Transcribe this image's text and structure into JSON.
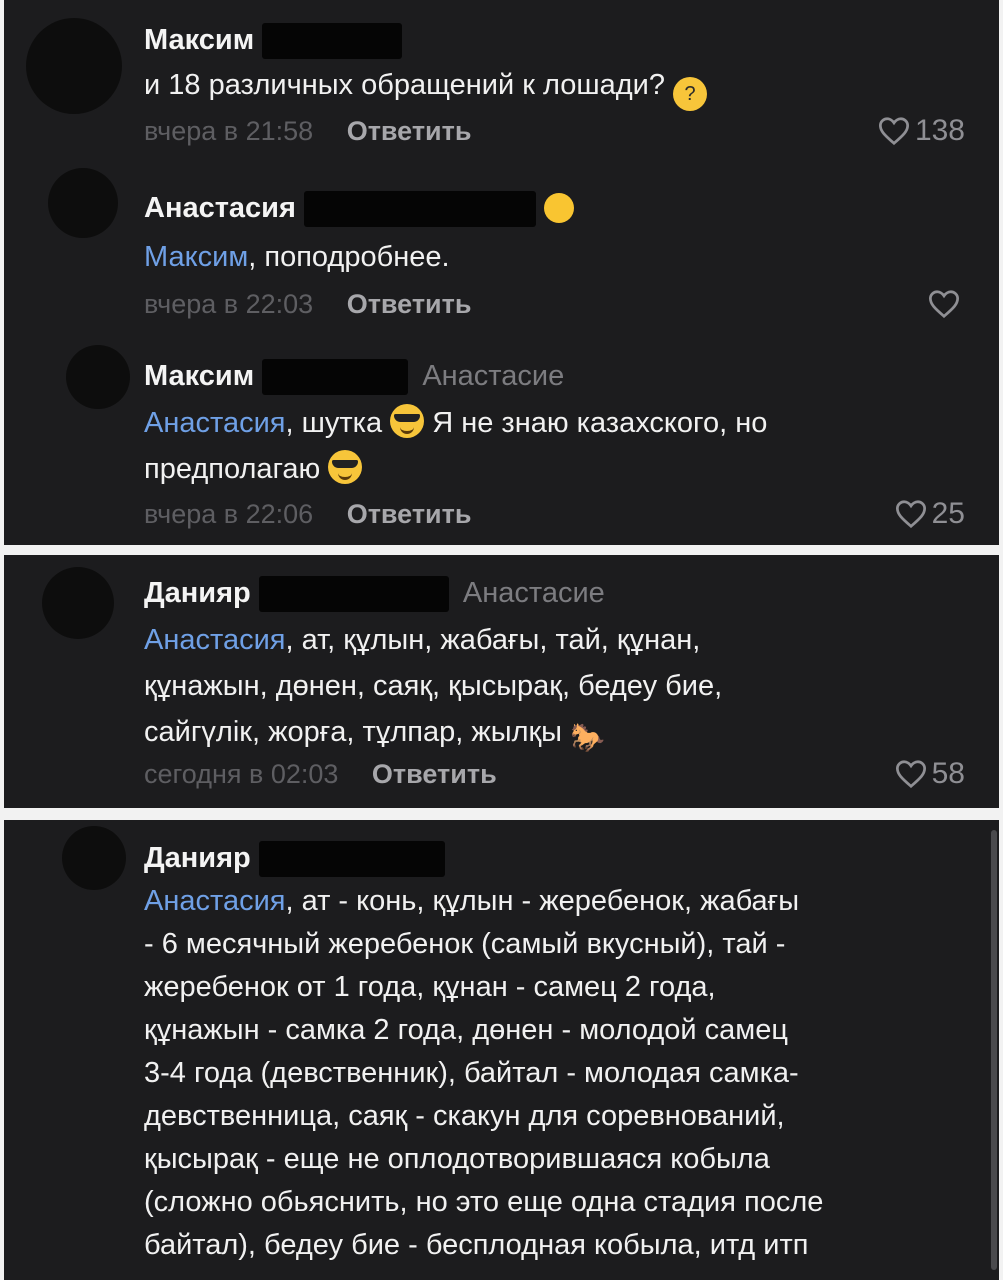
{
  "comments": [
    {
      "author": "Максим",
      "text": "и 18 различных обращений к лошади?",
      "emoji_icon": "thinking-face-icon",
      "time": "вчера в 21:58",
      "reply_label": "Ответить",
      "likes": "138"
    },
    {
      "author": "Анастасия",
      "mention": "Максим",
      "text": ", поподробнее.",
      "time": "вчера в 22:03",
      "reply_label": "Ответить",
      "likes": ""
    },
    {
      "author": "Максим",
      "reply_to": "Анастасие",
      "mention": "Анастасия",
      "text_part1": ", шутка",
      "text_part2": "Я не знаю казахского, но",
      "text_part3": "предполагаю",
      "emoji_icon": "smiling-face-with-sunglasses-icon",
      "time": "вчера в 22:06",
      "reply_label": "Ответить",
      "likes": "25"
    },
    {
      "author": "Данияр",
      "reply_to": "Анастасие",
      "mention": "Анастасия",
      "text_line1": ", ат, құлын, жабағы, тай, құнан,",
      "text_line2": "құнажын, дөнен, саяқ, қысырақ, бедеу бие,",
      "text_line3": "сайгүлік, жорға, тұлпар, жылқы",
      "emoji_icon": "horse-icon",
      "time": "сегодня в 02:03",
      "reply_label": "Ответить",
      "likes": "58"
    },
    {
      "author": "Данияр",
      "mention": "Анастасия",
      "text_line1": ", ат - конь, құлын - жеребенок, жабағы",
      "text_line2": "- 6 месячный жеребенок (самый вкусный), тай -",
      "text_line3": "жеребенок от 1 года, құнан - самец 2 года,",
      "text_line4": "құнажын - самка 2 года, дөнен - молодой самец",
      "text_line5": "3-4 года (девственник), байтал - молодая самка-",
      "text_line6": "девственница, саяқ - скакун для соревнований,",
      "text_line7": "қысырақ - еще не оплодотворившаяся кобыла",
      "text_line8": "(сложно обьяснить, но это еще одна стадия после",
      "text_line9": "байтал), бедеу бие - бесплодная кобыла, итд итп"
    }
  ],
  "colors": {
    "background": "#1c1c1e",
    "mention": "#6fa0e6",
    "meta": "#5e5e62"
  }
}
